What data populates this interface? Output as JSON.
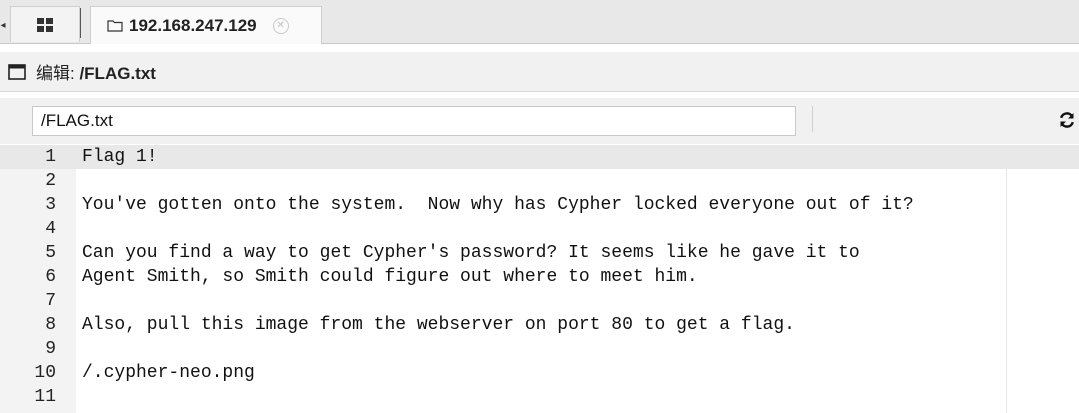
{
  "tabs": {
    "active_title": "192.168.247.129"
  },
  "editor": {
    "title_prefix": "编辑: ",
    "title_path": "/FLAG.txt"
  },
  "path": {
    "value": "/FLAG.txt"
  },
  "lines": [
    {
      "n": "1",
      "text": "Flag 1!"
    },
    {
      "n": "2",
      "text": ""
    },
    {
      "n": "3",
      "text": "You've gotten onto the system.  Now why has Cypher locked everyone out of it?"
    },
    {
      "n": "4",
      "text": ""
    },
    {
      "n": "5",
      "text": "Can you find a way to get Cypher's password? It seems like he gave it to"
    },
    {
      "n": "6",
      "text": "Agent Smith, so Smith could figure out where to meet him."
    },
    {
      "n": "7",
      "text": ""
    },
    {
      "n": "8",
      "text": "Also, pull this image from the webserver on port 80 to get a flag."
    },
    {
      "n": "9",
      "text": ""
    },
    {
      "n": "10",
      "text": "/.cypher-neo.png"
    },
    {
      "n": "11",
      "text": ""
    }
  ],
  "icons": {
    "grid": "grid-icon",
    "folder": "folder-icon",
    "close": "close-icon",
    "window": "window-icon",
    "refresh": "refresh-icon",
    "left_arrow": "caret-left-icon"
  }
}
